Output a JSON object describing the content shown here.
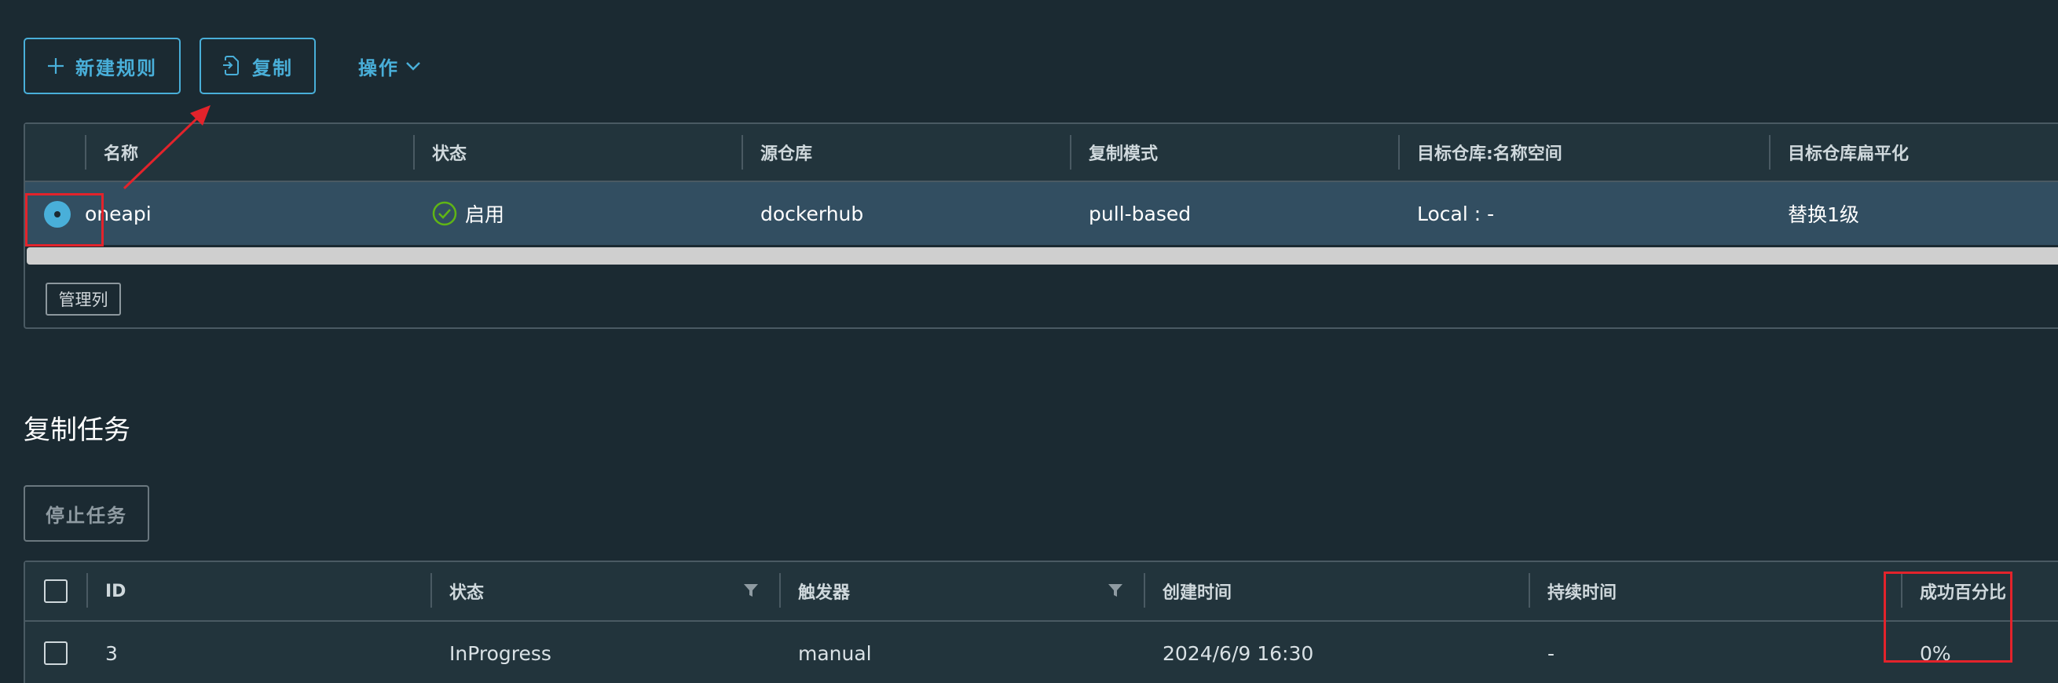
{
  "toolbar": {
    "new_rule_label": "新建规则",
    "copy_label": "复制",
    "operations_label": "操作"
  },
  "rules_grid": {
    "columns": [
      "名称",
      "状态",
      "源仓库",
      "复制模式",
      "目标仓库:名称空间",
      "目标仓库扁平化"
    ],
    "rows": [
      {
        "name": "oneapi",
        "status": "启用",
        "source_registry": "dockerhub",
        "mode": "pull-based",
        "target_namespace": "Local : -",
        "flatten": "替换1级"
      }
    ],
    "manage_columns_label": "管理列"
  },
  "tasks_section": {
    "title": "复制任务",
    "stop_label": "停止任务",
    "columns": [
      "ID",
      "状态",
      "触发器",
      "创建时间",
      "持续时间",
      "成功百分比"
    ],
    "rows": [
      {
        "id": "3",
        "status": "InProgress",
        "trigger": "manual",
        "created": "2024/6/9 16:30",
        "duration": "-",
        "success": "0%"
      }
    ]
  },
  "colors": {
    "background": "#1b2a32",
    "accent": "#49afd9",
    "selected_row": "#324e61",
    "success_green": "#60b515",
    "annotation_red": "#e3232b"
  },
  "icons": [
    "plus-icon",
    "copy-icon",
    "chevron-down-icon",
    "check-circle-icon",
    "filter-icon"
  ]
}
